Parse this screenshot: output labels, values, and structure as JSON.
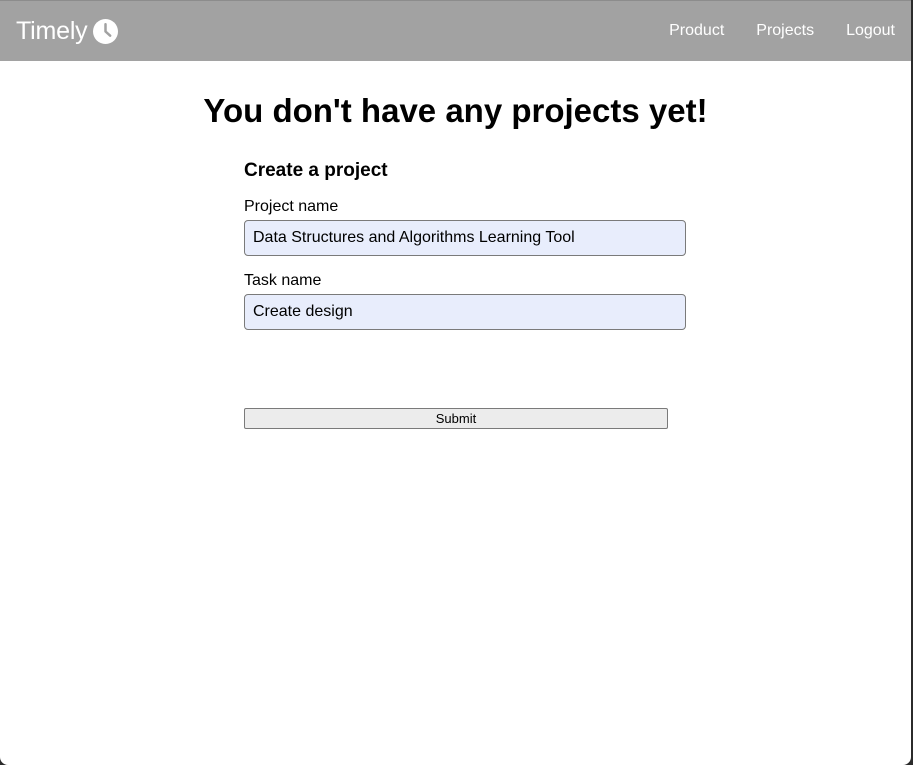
{
  "navbar": {
    "brand": "Timely",
    "brand_icon": "clock-icon",
    "links": [
      {
        "label": "Product"
      },
      {
        "label": "Projects"
      },
      {
        "label": "Logout"
      }
    ],
    "background_color": "#a2a2a2",
    "text_color": "#ffffff"
  },
  "main": {
    "heading": "You don't have any projects yet!",
    "form": {
      "title": "Create a project",
      "project_name_label": "Project name",
      "project_name_value": "Data Structures and Algorithms Learning Tool",
      "task_name_label": "Task name",
      "task_name_value": "Create design",
      "submit_label": "Submit",
      "input_background": "#e8edfc"
    }
  }
}
